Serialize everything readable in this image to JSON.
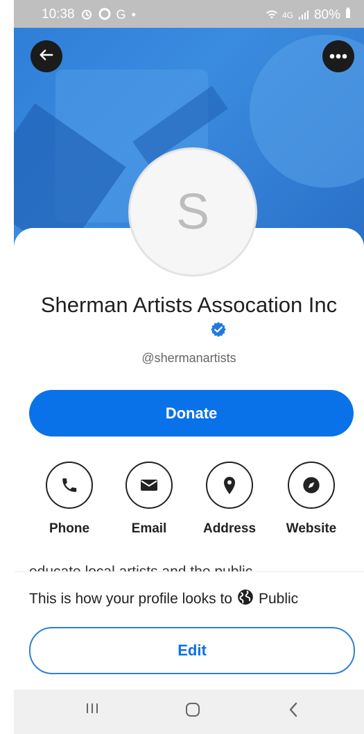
{
  "status_bar": {
    "time": "10:38",
    "left_icons": [
      "alarm-icon",
      "circle-icon",
      "G",
      "•"
    ],
    "right_icons": [
      "wifi-icon",
      "4G",
      "signal-icon"
    ],
    "battery": "80%"
  },
  "profile": {
    "avatar_initial": "S",
    "name": "Sherman Artists Assocation Inc",
    "verified": true,
    "handle": "@shermanartists",
    "description_fragment": "educate local artists and the public"
  },
  "buttons": {
    "donate": "Donate",
    "edit": "Edit"
  },
  "actions": [
    {
      "label": "Phone",
      "icon": "phone-icon"
    },
    {
      "label": "Email",
      "icon": "email-icon"
    },
    {
      "label": "Address",
      "icon": "location-pin-icon"
    },
    {
      "label": "Website",
      "icon": "compass-icon"
    }
  ],
  "visibility": {
    "prefix": "This is how your profile looks to",
    "audience": "Public",
    "icon": "globe-icon"
  },
  "colors": {
    "accent": "#0a72e8",
    "banner": "#2f7ed8",
    "status_bar": "#bfbfbf",
    "nav_bar": "#f0f0f0"
  }
}
